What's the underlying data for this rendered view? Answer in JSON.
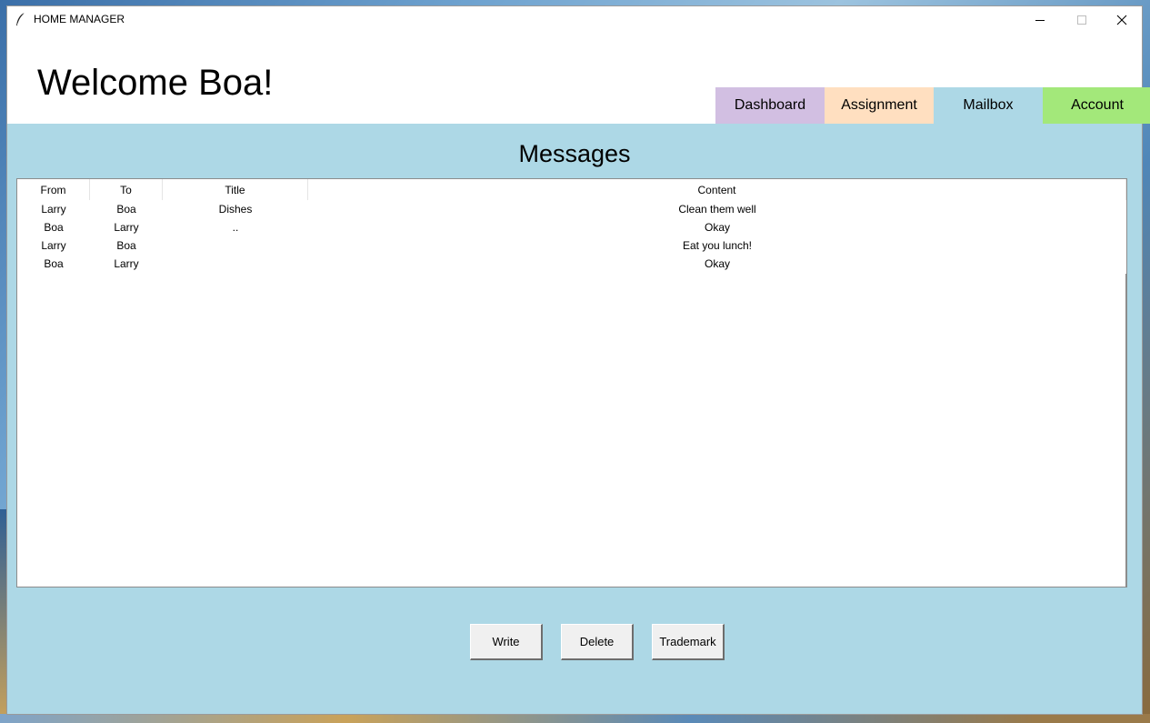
{
  "window": {
    "title": "HOME MANAGER"
  },
  "header": {
    "welcome": "Welcome Boa!"
  },
  "tabs": [
    {
      "label": "Dashboard",
      "color": "#d2bfe2"
    },
    {
      "label": "Assignment",
      "color": "#ffdfc0"
    },
    {
      "label": "Mailbox",
      "color": "#add8e6"
    },
    {
      "label": "Account",
      "color": "#a3e87a"
    }
  ],
  "main": {
    "section_title": "Messages",
    "background_color": "#add8e6"
  },
  "table": {
    "columns": [
      "From",
      "To",
      "Title",
      "Content"
    ],
    "rows": [
      {
        "from": "Larry",
        "to": "Boa",
        "title": "Dishes",
        "content": "Clean them well"
      },
      {
        "from": "Boa",
        "to": "Larry",
        "title": "..",
        "content": "Okay"
      },
      {
        "from": "Larry",
        "to": "Boa",
        "title": "",
        "content": "Eat you lunch!"
      },
      {
        "from": "Boa",
        "to": "Larry",
        "title": "",
        "content": "Okay"
      }
    ]
  },
  "actions": {
    "write": "Write",
    "delete": "Delete",
    "trademark": "Trademark"
  },
  "icons": {
    "app": "feather-icon",
    "minimize": "minimize-icon",
    "maximize": "maximize-icon",
    "close": "close-icon"
  }
}
